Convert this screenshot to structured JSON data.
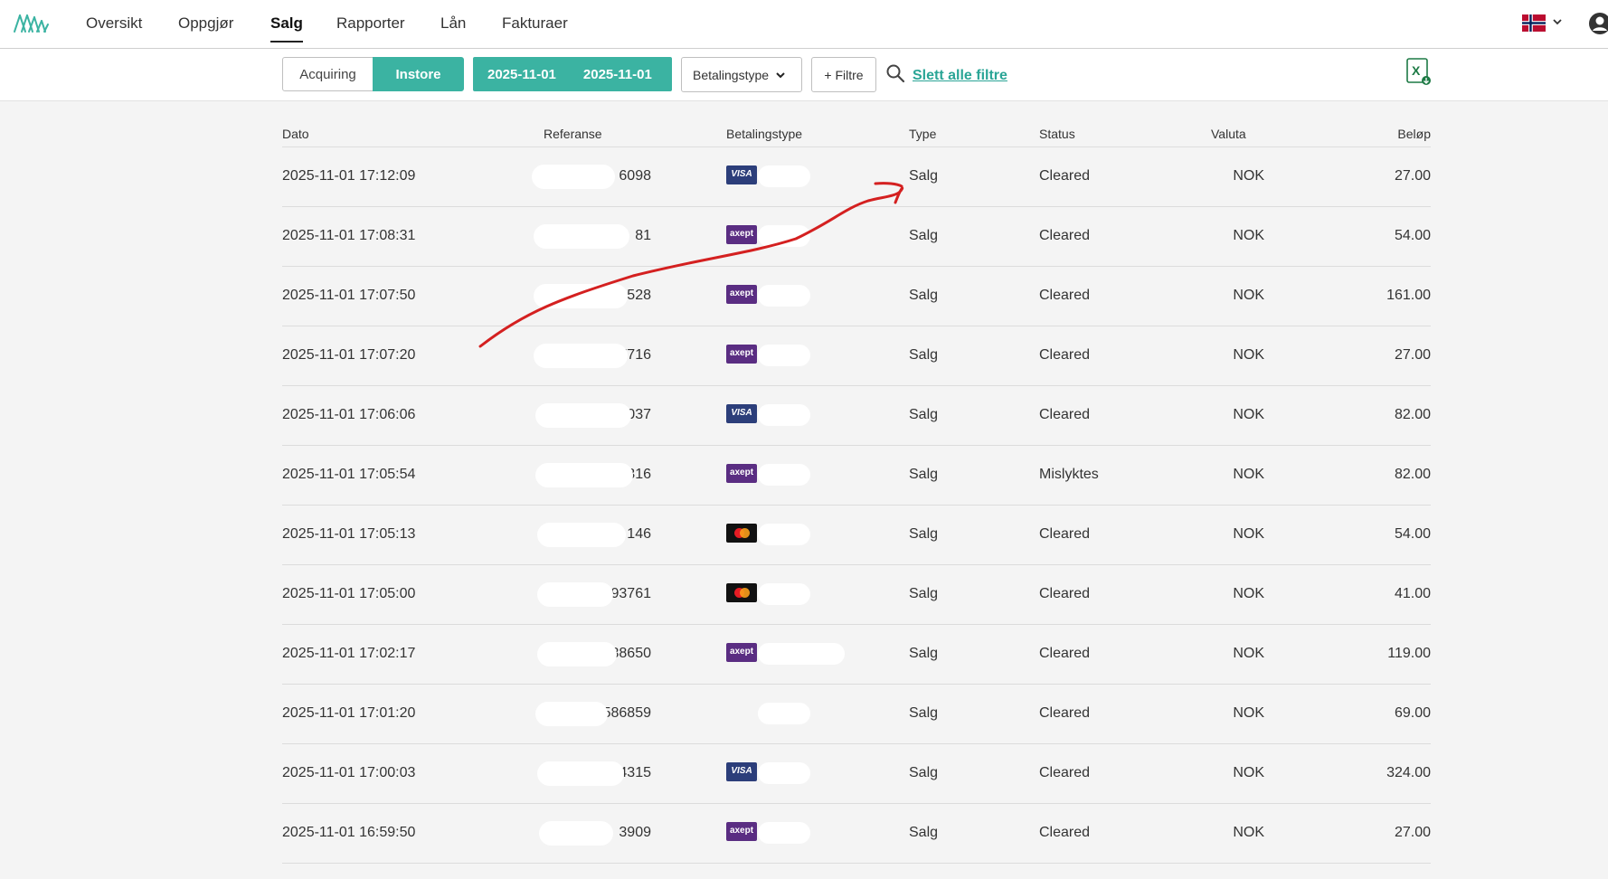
{
  "nav": {
    "items": [
      {
        "label": "Oversikt",
        "active": false
      },
      {
        "label": "Oppgjør",
        "active": false
      },
      {
        "label": "Salg",
        "active": true
      },
      {
        "label": "Rapporter",
        "active": false
      },
      {
        "label": "Lån",
        "active": false
      },
      {
        "label": "Fakturaer",
        "active": false
      }
    ]
  },
  "filters": {
    "segments": [
      "Acquiring",
      "Instore"
    ],
    "active_segment": "Instore",
    "date_from": "2025-11-01",
    "date_to": "2025-11-01",
    "payment_type_label": "Betalingstype",
    "add_filter_label": "+ Filtre",
    "clear_filters_label": "Slett alle filtre"
  },
  "table": {
    "headers": {
      "date": "Dato",
      "reference": "Referanse",
      "payment_type": "Betalingstype",
      "type": "Type",
      "status": "Status",
      "currency": "Valuta",
      "amount": "Beløp"
    },
    "rows": [
      {
        "date": "2025-11-01 17:12:09",
        "reference": "6098",
        "card": "visa",
        "type": "Salg",
        "status": "Cleared",
        "currency": "NOK",
        "amount": "27.00"
      },
      {
        "date": "2025-11-01 17:08:31",
        "reference": "81",
        "card": "axept",
        "type": "Salg",
        "status": "Cleared",
        "currency": "NOK",
        "amount": "54.00"
      },
      {
        "date": "2025-11-01 17:07:50",
        "reference": "528",
        "card": "axept",
        "type": "Salg",
        "status": "Cleared",
        "currency": "NOK",
        "amount": "161.00"
      },
      {
        "date": "2025-11-01 17:07:20",
        "reference": "4597716",
        "card": "axept",
        "type": "Salg",
        "status": "Cleared",
        "currency": "NOK",
        "amount": "27.00"
      },
      {
        "date": "2025-11-01 17:06:06",
        "reference": "037",
        "card": "visa",
        "type": "Salg",
        "status": "Cleared",
        "currency": "NOK",
        "amount": "82.00"
      },
      {
        "date": "2025-11-01 17:05:54",
        "reference": "316",
        "card": "axept",
        "type": "Salg",
        "status": "Mislyktes",
        "currency": "NOK",
        "amount": "82.00"
      },
      {
        "date": "2025-11-01 17:05:13",
        "reference": "146",
        "card": "mastercard",
        "type": "Salg",
        "status": "Cleared",
        "currency": "NOK",
        "amount": "54.00"
      },
      {
        "date": "2025-11-01 17:05:00",
        "reference": "93761",
        "card": "mastercard",
        "type": "Salg",
        "status": "Cleared",
        "currency": "NOK",
        "amount": "41.00"
      },
      {
        "date": "2025-11-01 17:02:17",
        "reference": "38650",
        "card": "axept",
        "type": "Salg",
        "status": "Cleared",
        "currency": "NOK",
        "amount": "119.00"
      },
      {
        "date": "2025-11-01 17:01:20",
        "reference": "586859",
        "card": "none",
        "type": "Salg",
        "status": "Cleared",
        "currency": "NOK",
        "amount": "69.00"
      },
      {
        "date": "2025-11-01 17:00:03",
        "reference": "34315",
        "card": "visa",
        "type": "Salg",
        "status": "Cleared",
        "currency": "NOK",
        "amount": "324.00"
      },
      {
        "date": "2025-11-01 16:59:50",
        "reference": "3909",
        "card": "axept",
        "type": "Salg",
        "status": "Cleared",
        "currency": "NOK",
        "amount": "27.00"
      }
    ]
  },
  "colors": {
    "accent": "#3bb3a2",
    "link": "#2aa596",
    "annotation": "#d42020"
  },
  "icons": [
    "brand-logo-icon",
    "norway-flag-icon",
    "chevron-down-icon",
    "user-account-icon",
    "search-icon",
    "excel-export-icon"
  ]
}
